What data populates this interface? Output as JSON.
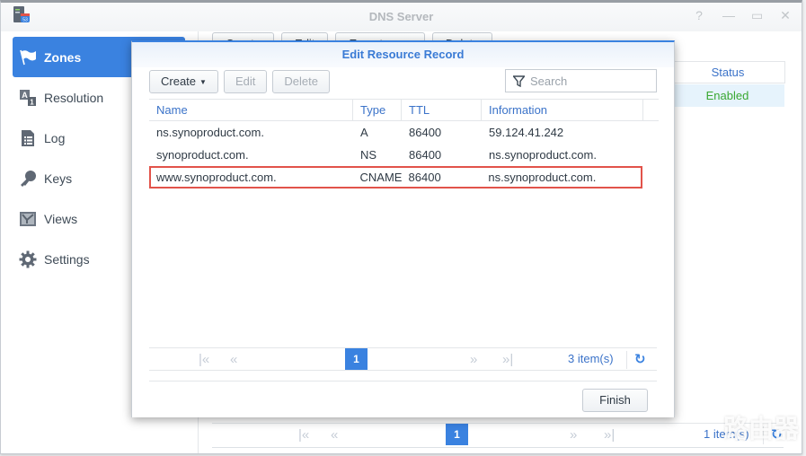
{
  "window": {
    "title": "DNS Server",
    "controls": {
      "help": "?",
      "minimize": "—",
      "maximize": "▭",
      "close": "✕"
    }
  },
  "sidebar": {
    "items": [
      {
        "label": "Zones",
        "icon": "flag-icon",
        "active": true
      },
      {
        "label": "Resolution",
        "icon": "resolution-icon",
        "active": false
      },
      {
        "label": "Log",
        "icon": "log-icon",
        "active": false
      },
      {
        "label": "Keys",
        "icon": "key-icon",
        "active": false
      },
      {
        "label": "Views",
        "icon": "views-icon",
        "active": false
      },
      {
        "label": "Settings",
        "icon": "gear-icon",
        "active": false
      }
    ]
  },
  "main": {
    "toolbar": {
      "create": "Create",
      "edit": "Edit",
      "export": "Export zone",
      "delete": "Delete"
    },
    "grid": {
      "status_header": "Status",
      "rows": [
        {
          "status": "Enabled"
        }
      ]
    },
    "pager": {
      "page": "1",
      "count": "1 item(s)"
    }
  },
  "dialog": {
    "title": "Edit Resource Record",
    "toolbar": {
      "create": "Create",
      "edit": "Edit",
      "delete": "Delete"
    },
    "search": {
      "placeholder": "Search",
      "value": ""
    },
    "columns": {
      "name": "Name",
      "type": "Type",
      "ttl": "TTL",
      "info": "Information"
    },
    "rows": [
      {
        "name": "ns.synoproduct.com.",
        "type": "A",
        "ttl": "86400",
        "info": "59.124.41.242",
        "highlighted": false
      },
      {
        "name": "synoproduct.com.",
        "type": "NS",
        "ttl": "86400",
        "info": "ns.synoproduct.com.",
        "highlighted": false
      },
      {
        "name": "www.synoproduct.com.",
        "type": "CNAME",
        "ttl": "86400",
        "info": "ns.synoproduct.com.",
        "highlighted": true
      }
    ],
    "pager": {
      "page": "1",
      "count": "3 item(s)"
    },
    "finish": "Finish"
  },
  "colors": {
    "accent": "#3a82e0",
    "highlight_border": "#e2534a",
    "status_enabled": "#3aa832",
    "header_text": "#3b73c9"
  },
  "watermark": "路由器"
}
